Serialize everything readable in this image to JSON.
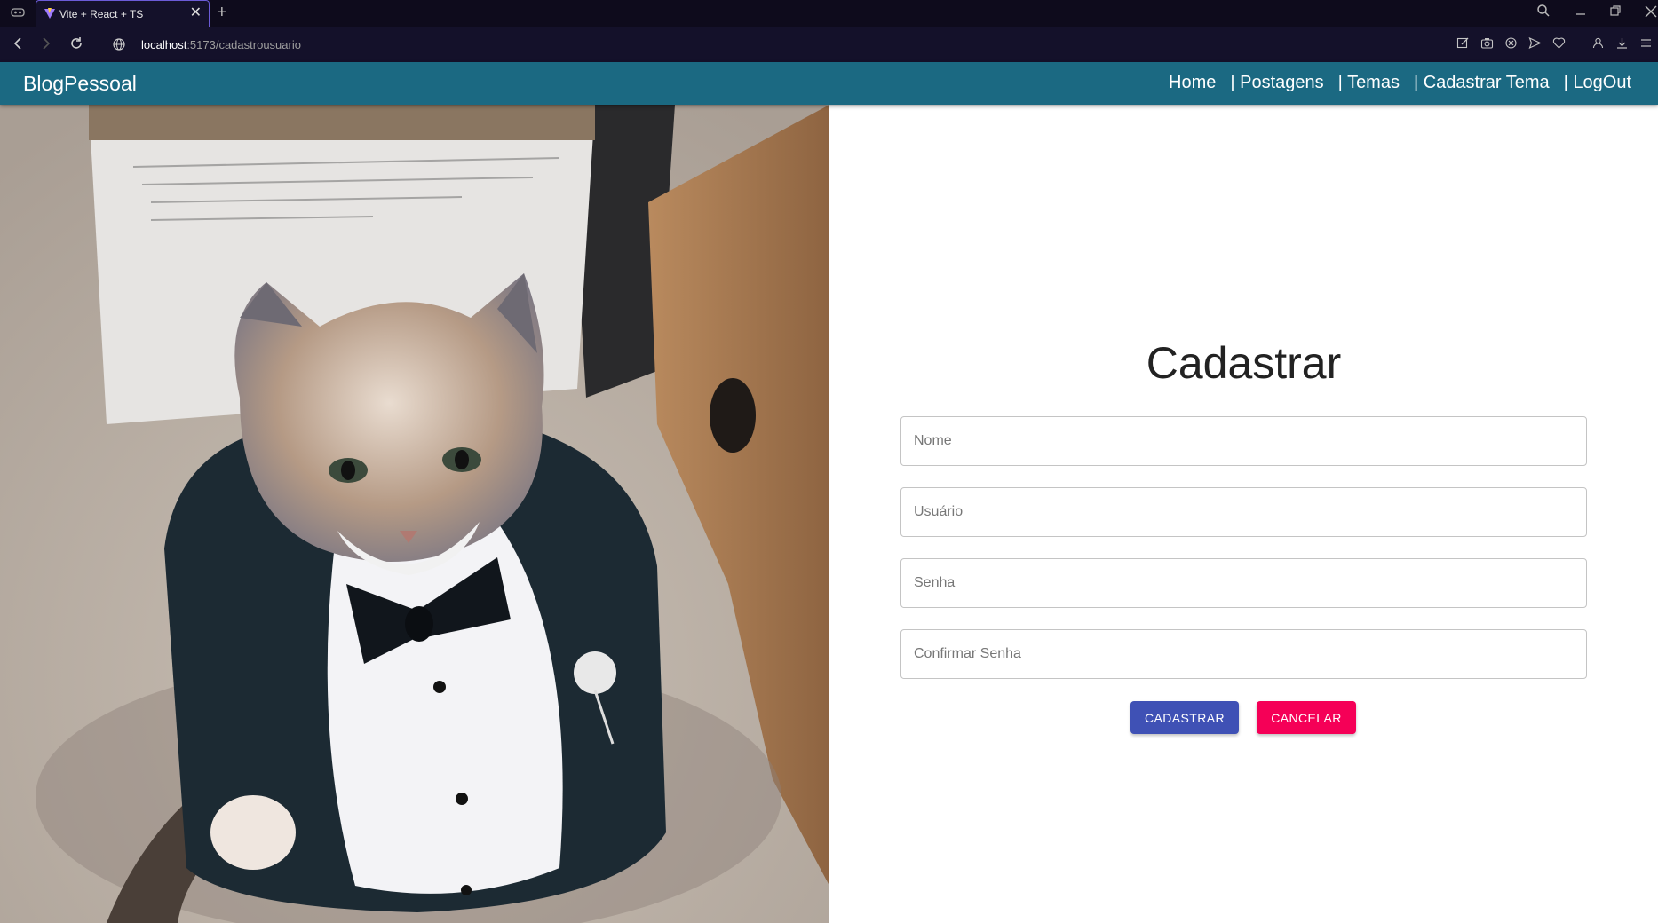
{
  "browser": {
    "tab_title": "Vite + React + TS",
    "url_host": "localhost",
    "url_path": ":5173/cadastrousuario",
    "icons": [
      "extensions-icon",
      "vite-favicon",
      "close-icon",
      "plus-icon",
      "search-icon",
      "minimize-icon",
      "restore-icon",
      "close-window-icon",
      "back-icon",
      "forward-icon",
      "reload-icon",
      "globe-icon",
      "edit-icon",
      "camera-icon",
      "shield-icon",
      "send-icon",
      "heart-icon",
      "account-icon",
      "download-icon",
      "menu-icon"
    ]
  },
  "navbar": {
    "brand": "BlogPessoal",
    "links": [
      "Home",
      "| Postagens",
      "| Temas",
      "| Cadastrar Tema",
      "| LogOut"
    ],
    "background": "#1b6982"
  },
  "form": {
    "title": "Cadastrar",
    "fields": [
      {
        "placeholder": "Nome",
        "value": ""
      },
      {
        "placeholder": "Usuário",
        "value": ""
      },
      {
        "placeholder": "Senha",
        "value": ""
      },
      {
        "placeholder": "Confirmar Senha",
        "value": ""
      }
    ],
    "submit_label": "CADASTRAR",
    "cancel_label": "CANCELAR",
    "submit_color": "#3f51b5",
    "cancel_color": "#f50057"
  }
}
